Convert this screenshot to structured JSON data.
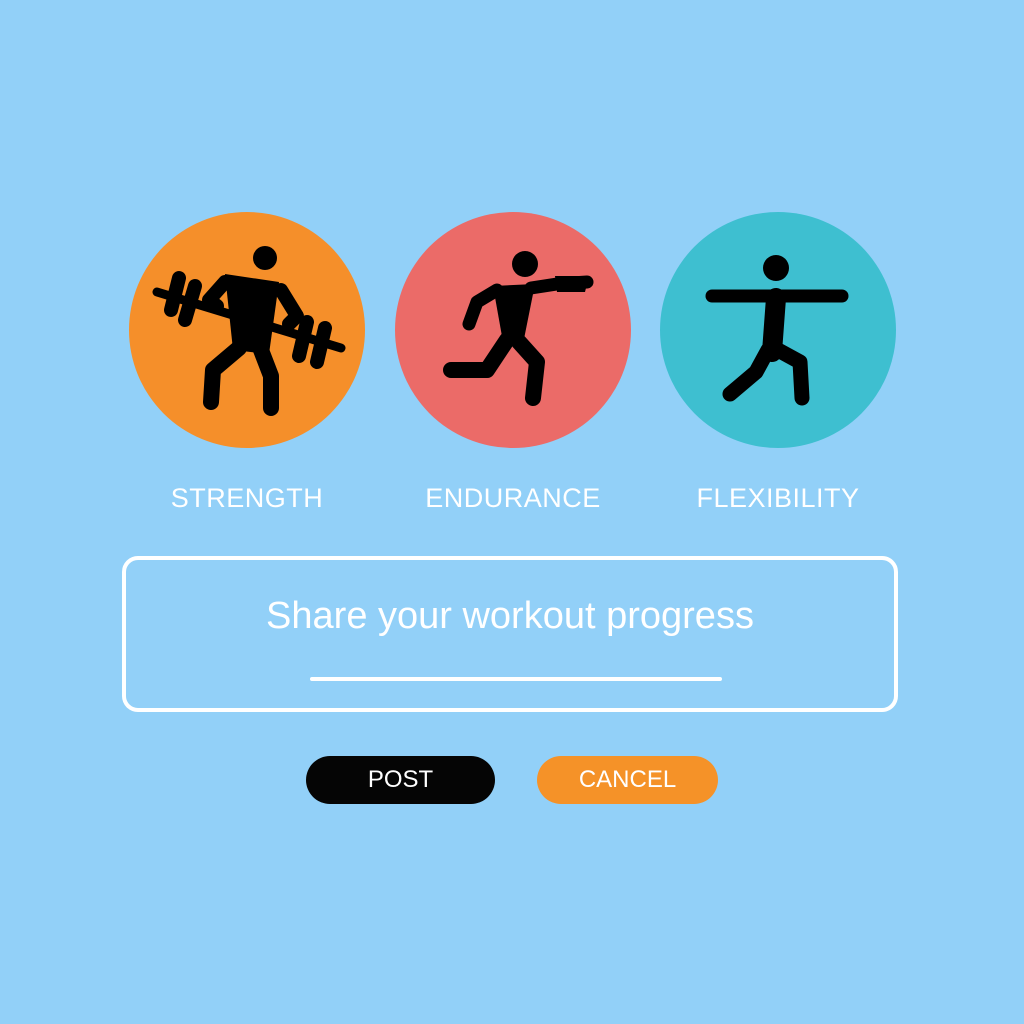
{
  "categories": [
    {
      "id": "strength",
      "label": "STRENGTH",
      "icon": "weightlifter-icon",
      "color": "#f58f2a"
    },
    {
      "id": "endurance",
      "label": "ENDURANCE",
      "icon": "runner-icon",
      "color": "#eb6b68"
    },
    {
      "id": "flexibility",
      "label": "FLEXIBILITY",
      "icon": "stretching-figure-icon",
      "color": "#3ebfd0"
    }
  ],
  "post_box": {
    "prompt": "Share your workout progress"
  },
  "actions": {
    "post_label": "POST",
    "cancel_label": "CANCEL"
  },
  "colors": {
    "background": "#92d0f8",
    "post_button": "#050505",
    "cancel_button": "#f59228"
  }
}
